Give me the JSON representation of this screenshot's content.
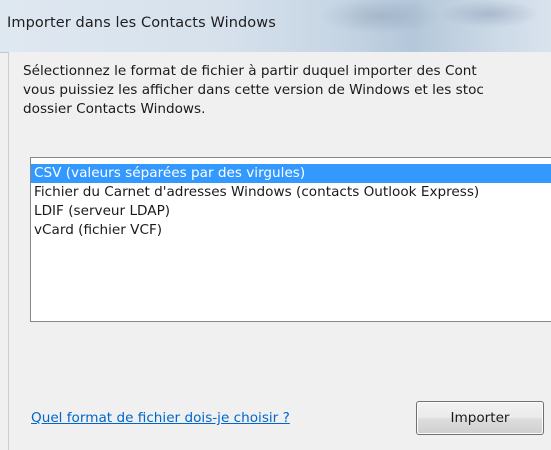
{
  "window": {
    "title": "Importer dans les Contacts Windows"
  },
  "dialog": {
    "description": "Sélectionnez le format de fichier à partir duquel importer des Cont\nvous puissiez les afficher dans cette version de Windows et les stoc\ndossier Contacts Windows.",
    "formats": [
      {
        "label": "CSV (valeurs séparées par des virgules)",
        "selected": true
      },
      {
        "label": "Fichier du Carnet d'adresses Windows (contacts Outlook Express)",
        "selected": false
      },
      {
        "label": "LDIF (serveur LDAP)",
        "selected": false
      },
      {
        "label": "vCard (fichier VCF)",
        "selected": false
      }
    ],
    "help_link": "Quel format de fichier dois-je choisir ?",
    "import_button": "Importer"
  }
}
